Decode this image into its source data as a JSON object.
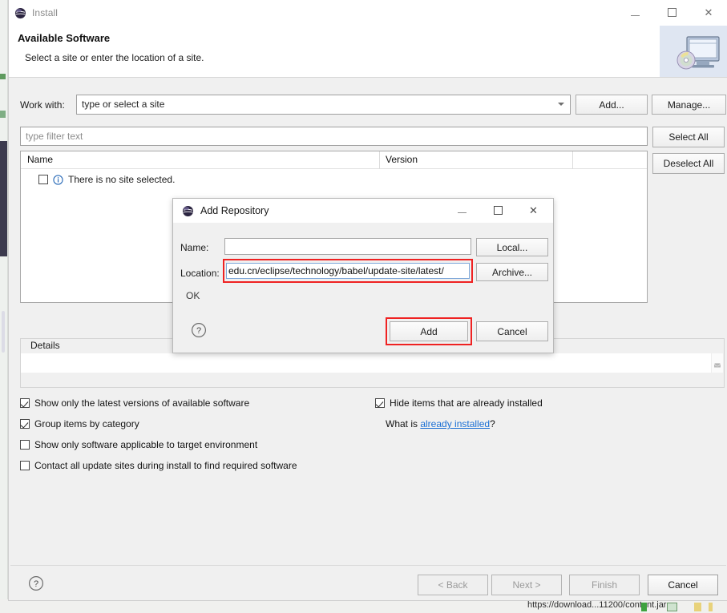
{
  "window": {
    "title": "Install",
    "icon": "eclipse-globe-icon",
    "minimize": "–",
    "maximize": "□",
    "close": "✕"
  },
  "header": {
    "title": "Available Software",
    "subtitle": "Select a site or enter the location of a site.",
    "artwork_icon": "computer-with-cd-icon"
  },
  "work_with": {
    "label": "Work with:",
    "value": "type or select a site",
    "dropdown_icon": "chevron-down-icon",
    "add_button": "Add...",
    "manage_button": "Manage..."
  },
  "filter": {
    "placeholder": "type filter text",
    "value": "",
    "select_all_button": "Select All",
    "deselect_all_button": "Deselect All"
  },
  "table": {
    "columns": [
      "Name",
      "Version"
    ],
    "rows": [
      {
        "checked": false,
        "icon": "info-circle-icon",
        "name": "There is no site selected.",
        "version": ""
      }
    ]
  },
  "details": {
    "label": "Details",
    "content": "",
    "scroll_icon": "scroll-handle-icon"
  },
  "options": {
    "left": [
      {
        "label": "Show only the latest versions of available software",
        "checked": true
      },
      {
        "label": "Group items by category",
        "checked": true
      },
      {
        "label": "Show only software applicable to target environment",
        "checked": false
      },
      {
        "label": "Contact all update sites during install to find required software",
        "checked": false
      }
    ],
    "right": [
      {
        "label": "Hide items that are already installed",
        "checked": true
      }
    ],
    "what_is_prefix": "What is ",
    "what_is_link": "already installed",
    "what_is_suffix": "?"
  },
  "bottom_bar": {
    "help_icon": "question-mark-icon",
    "back_button": "< Back",
    "next_button": "Next >",
    "finish_button": "Finish",
    "cancel_button": "Cancel"
  },
  "add_repository_dialog": {
    "title": "Add Repository",
    "icon": "eclipse-globe-icon",
    "minimize": "–",
    "maximize": "□",
    "close": "✕",
    "name_label": "Name:",
    "name_value": "",
    "local_button": "Local...",
    "location_label": "Location:",
    "location_value": "edu.cn/eclipse/technology/babel/update-site/latest/",
    "archive_button": "Archive...",
    "status_message": "OK",
    "help_icon": "question-mark-icon",
    "add_button": "Add",
    "cancel_button": "Cancel",
    "highlight_color": "#ef2222"
  },
  "background": {
    "bottom_url_text": "https://download...11200/content.jar"
  }
}
